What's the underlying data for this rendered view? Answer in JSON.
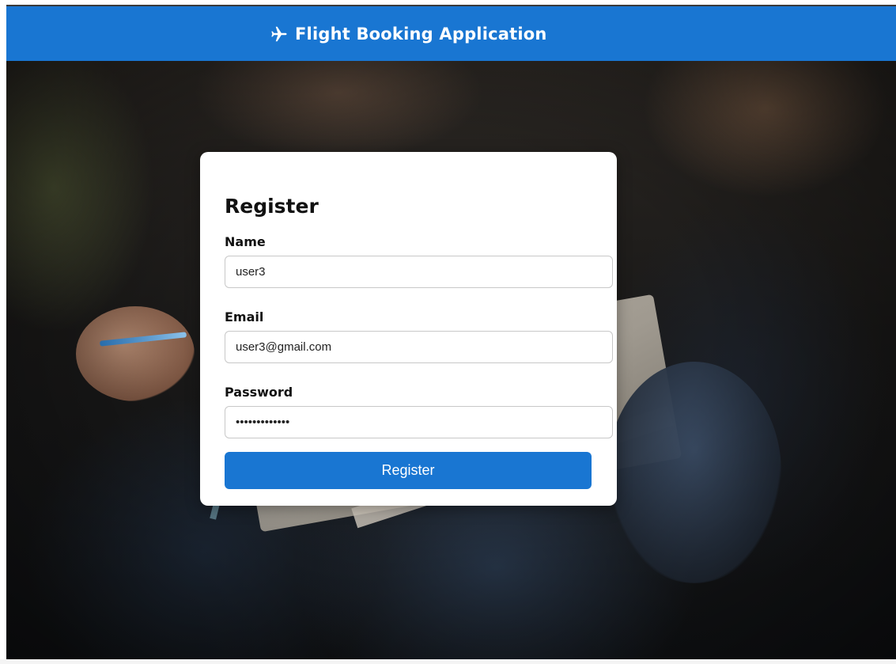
{
  "header": {
    "title": "Flight Booking Application",
    "icon": "airplane-icon",
    "background_color": "#1976d2"
  },
  "form": {
    "heading": "Register",
    "fields": {
      "name": {
        "label": "Name",
        "value": "user3"
      },
      "email": {
        "label": "Email",
        "value": "user3@gmail.com"
      },
      "password": {
        "label": "Password",
        "value": "•••••••••••••"
      }
    },
    "submit_label": "Register",
    "button_color": "#1976d2"
  }
}
